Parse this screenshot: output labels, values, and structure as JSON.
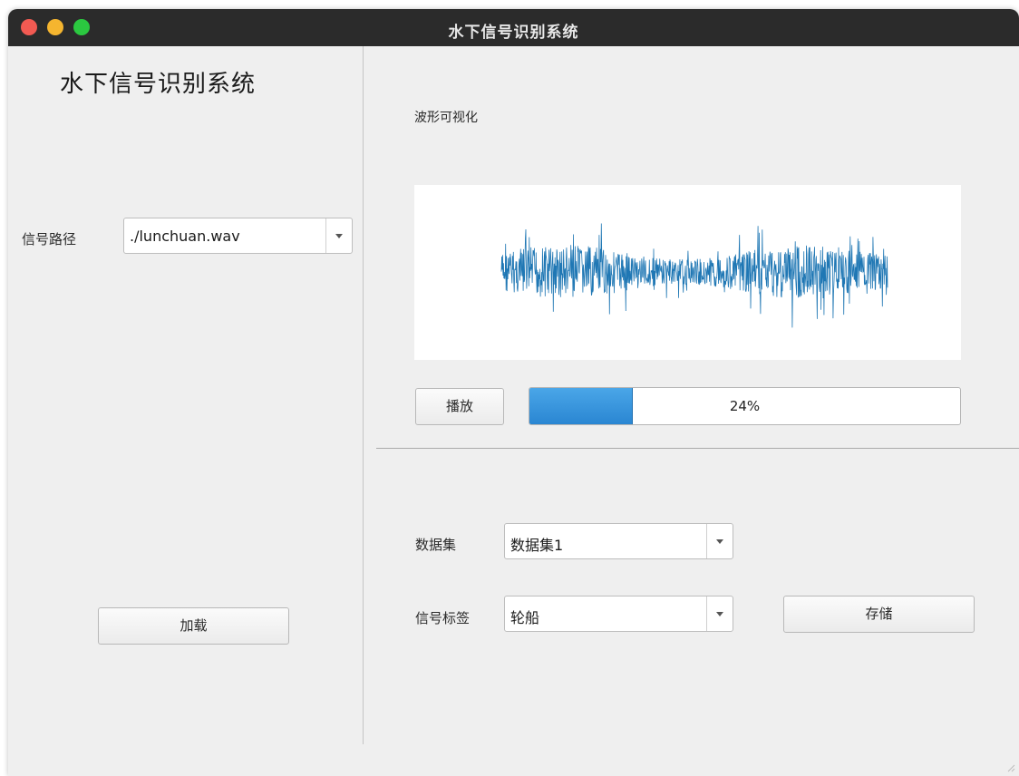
{
  "window": {
    "title": "水下信号识别系统"
  },
  "left": {
    "app_title": "水下信号识别系统",
    "signal_path_label": "信号路径",
    "signal_path_value": "./lunchuan.wav",
    "load_button": "加载"
  },
  "right": {
    "waveform_label": "波形可视化",
    "play_button": "播放",
    "progress": {
      "value": 24,
      "text": "24%"
    },
    "dataset_label": "数据集",
    "dataset_value": "数据集1",
    "signal_tag_label": "信号标签",
    "signal_tag_value": "轮船",
    "save_button": "存储"
  },
  "colors": {
    "titlebar": "#2b2b2b",
    "waveform": "#1f77b4",
    "progress_fill": "#3a96dd",
    "close": "#f25a52",
    "minimize": "#f5b52f",
    "maximize": "#2bc840"
  },
  "icons": [
    "close-icon",
    "minimize-icon",
    "maximize-icon",
    "chevron-down-icon"
  ]
}
